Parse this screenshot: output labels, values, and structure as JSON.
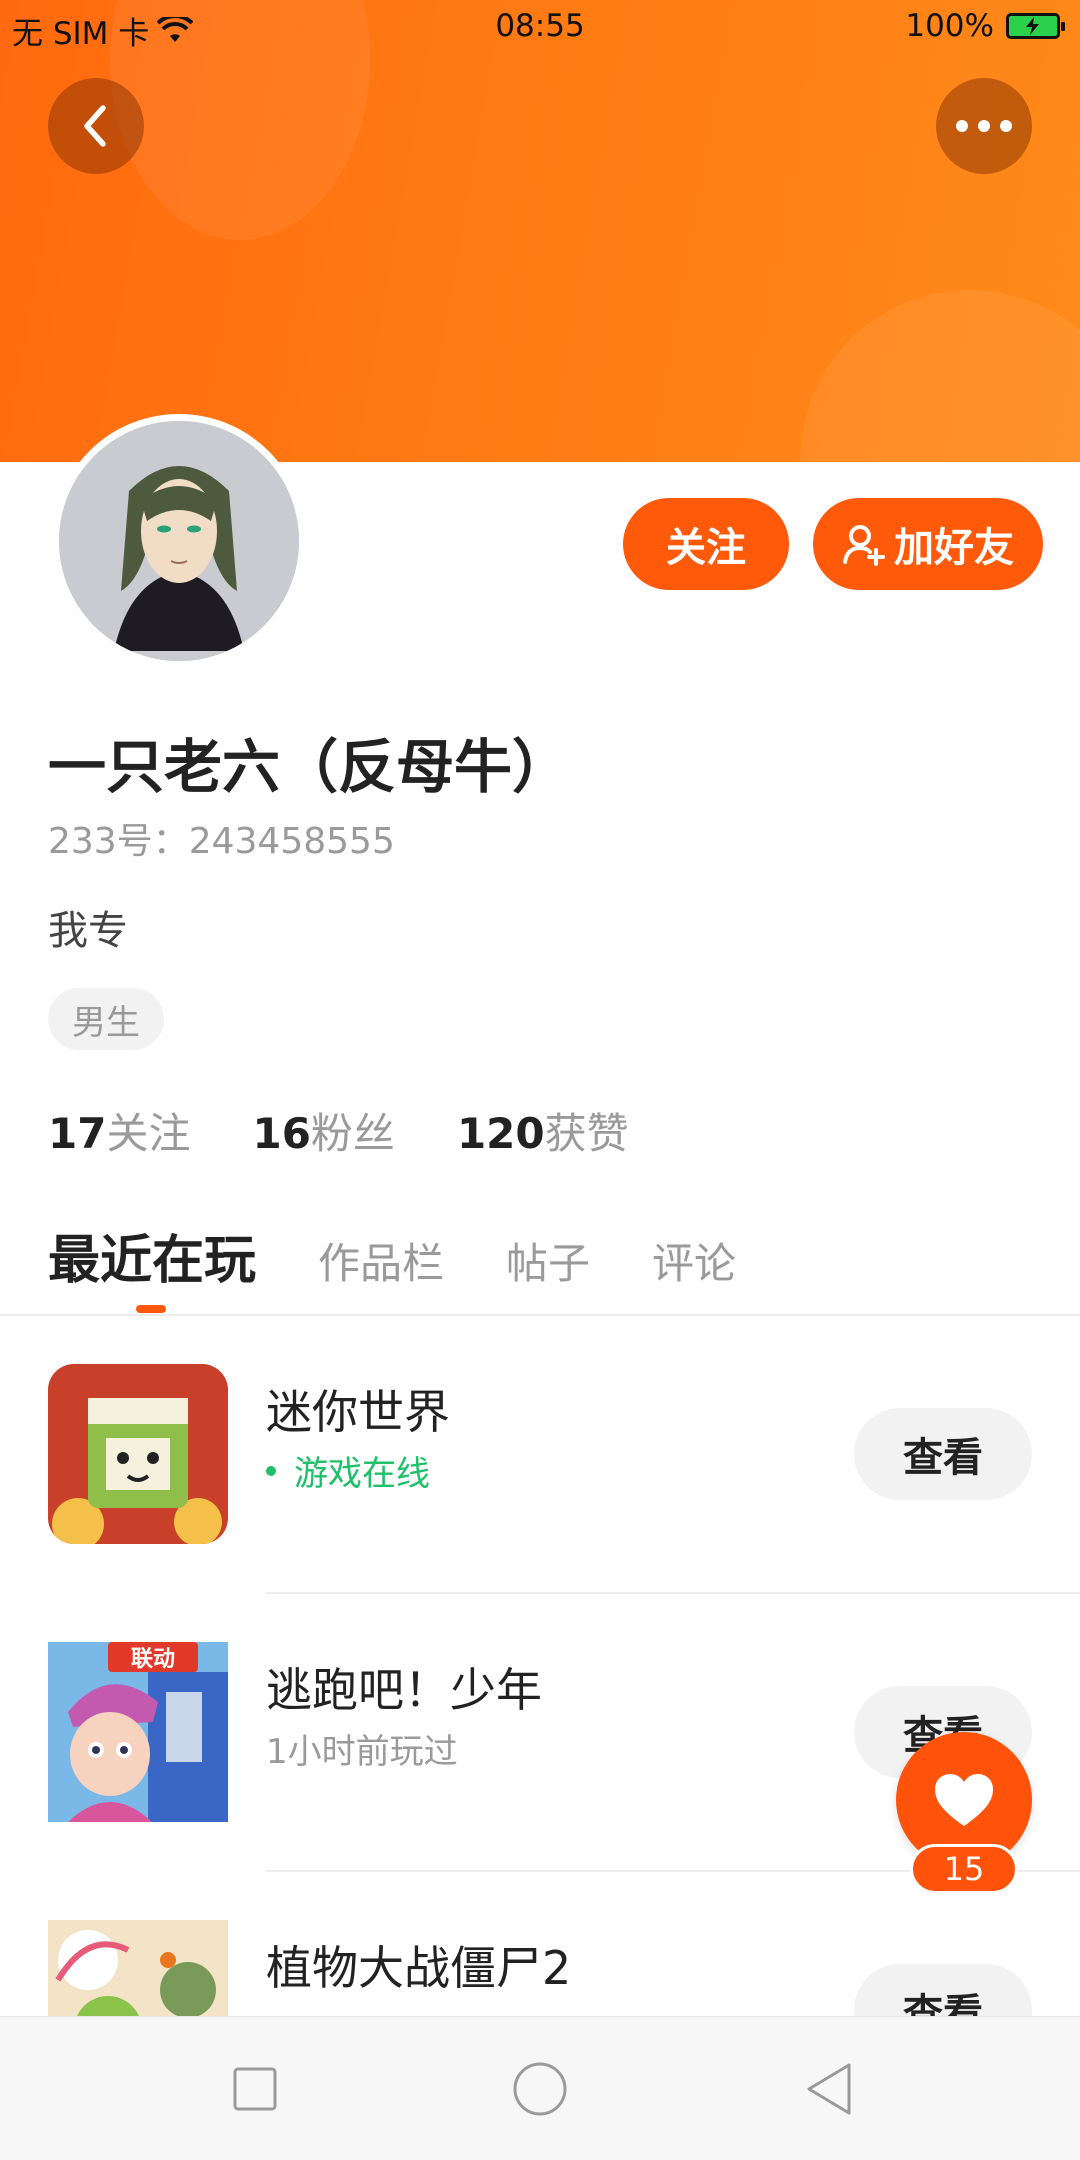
{
  "status_bar": {
    "carrier": "无 SIM 卡",
    "time": "08:55",
    "battery": "100%"
  },
  "header": {
    "back_icon": "chevron-left-icon",
    "more_icon": "more-dots-icon"
  },
  "profile": {
    "follow_label": "关注",
    "add_friend_label": "加好友",
    "name": "一只老六（反母牛）",
    "uid": "233号：243458555",
    "bio": "我专",
    "gender_tag": "男生"
  },
  "stats": [
    {
      "num": "17",
      "label": "关注"
    },
    {
      "num": "16",
      "label": "粉丝"
    },
    {
      "num": "120",
      "label": "获赞"
    }
  ],
  "tabs": [
    {
      "label": "最近在玩",
      "active": true
    },
    {
      "label": "作品栏"
    },
    {
      "label": "帖子"
    },
    {
      "label": "评论"
    }
  ],
  "games": [
    {
      "title": "迷你世界",
      "status": "游戏在线",
      "online": true,
      "action": "查看"
    },
    {
      "title": "逃跑吧！少年",
      "status": "1小时前玩过",
      "online": false,
      "action": "查看",
      "badge": "联动"
    },
    {
      "title": "植物大战僵尸2",
      "status": "",
      "online": false,
      "action": "查看"
    }
  ],
  "like_fab": {
    "count": "15"
  },
  "colors": {
    "accent": "#ff5a0a",
    "online_green": "#20c06a",
    "banner": "#ff7a12"
  }
}
